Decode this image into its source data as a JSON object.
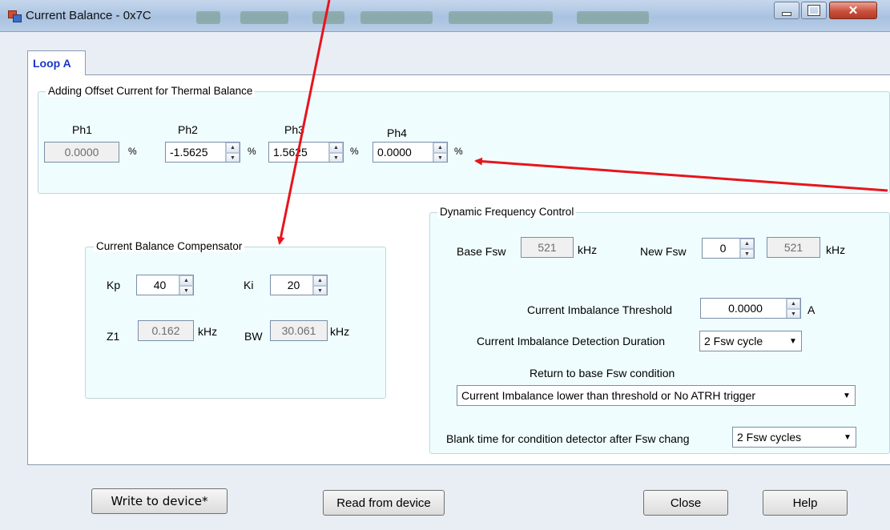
{
  "window": {
    "title": "Current Balance - 0x7C"
  },
  "tabs": [
    {
      "label": "Loop A"
    }
  ],
  "thermal": {
    "title": "Adding Offset Current for Thermal Balance",
    "phases": [
      {
        "label": "Ph1",
        "value": "0.0000",
        "unit": "%"
      },
      {
        "label": "Ph2",
        "value": "-1.5625",
        "unit": "%"
      },
      {
        "label": "Ph3",
        "value": "1.5625",
        "unit": "%"
      },
      {
        "label": "Ph4",
        "value": "0.0000",
        "unit": "%"
      }
    ]
  },
  "compensator": {
    "title": "Current Balance Compensator",
    "kp_label": "Kp",
    "kp_value": "40",
    "ki_label": "Ki",
    "ki_value": "20",
    "z1_label": "Z1",
    "z1_value": "0.162",
    "z1_unit": "kHz",
    "bw_label": "BW",
    "bw_value": "30.061",
    "bw_unit": "kHz"
  },
  "dfc": {
    "title": "Dynamic Frequency Control",
    "base_label": "Base Fsw",
    "base_value": "521",
    "base_unit": "kHz",
    "new_label": "New Fsw",
    "new_value": "0",
    "new_result": "521",
    "new_unit": "kHz",
    "threshold_label": "Current Imbalance Threshold",
    "threshold_value": "0.0000",
    "threshold_unit": "A",
    "duration_label": "Current Imbalance Detection Duration",
    "duration_value": "2 Fsw cycle",
    "return_label": "Return to base Fsw condition",
    "return_value": "Current Imbalance lower than threshold or No ATRH trigger",
    "blank_label": "Blank time for condition detector after Fsw chang",
    "blank_value": "2 Fsw cycles"
  },
  "buttons": {
    "write": "Write to device*",
    "read": "Read from device",
    "close": "Close",
    "help": "Help"
  },
  "icons": {
    "minimize": "minimize-icon",
    "maximize": "maximize-icon",
    "close": "close-icon"
  },
  "colors": {
    "tab_text": "#1a36c8",
    "group_bg": "#f0fdfe",
    "annotation_arrow": "#e8141c"
  }
}
